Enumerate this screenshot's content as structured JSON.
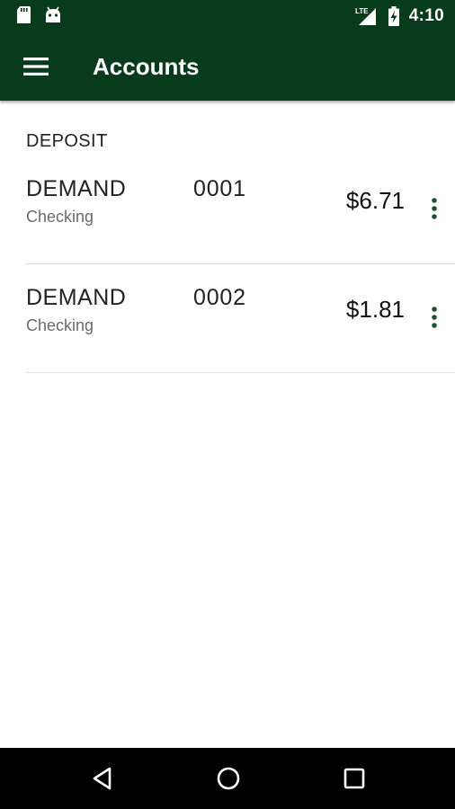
{
  "status_bar": {
    "time": "4:10",
    "network": "LTE",
    "icons": [
      "sd-card-icon",
      "android-icon",
      "lte-signal-icon",
      "battery-charging-icon"
    ]
  },
  "app_bar": {
    "title": "Accounts",
    "menu_icon": "hamburger-menu-icon"
  },
  "section": {
    "header": "DEPOSIT"
  },
  "accounts": [
    {
      "name": "DEMAND",
      "type": "Checking",
      "number": "0001",
      "balance": "$6.71"
    },
    {
      "name": "DEMAND",
      "type": "Checking",
      "number": "0002",
      "balance": "$1.81"
    }
  ],
  "nav_bar": {
    "icons": [
      "back-icon",
      "home-icon",
      "recents-icon"
    ]
  },
  "colors": {
    "primary": "#083a1c",
    "overflow_dots": "#1e5330",
    "nav_bar": "#000000",
    "divider": "#dedede"
  }
}
